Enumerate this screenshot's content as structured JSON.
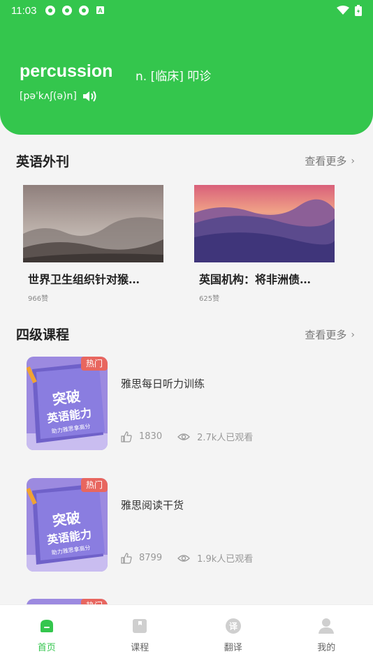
{
  "status_bar": {
    "time": "11:03"
  },
  "word_card": {
    "word": "percussion",
    "meaning": "n. [临床] 叩诊",
    "phonetic": "[pəˈkʌʃ(ə)n]"
  },
  "magazine_section": {
    "title": "英语外刊",
    "more_label": "查看更多",
    "articles": [
      {
        "title": "世界卫生组织针对猴…",
        "likes": "966赞"
      },
      {
        "title": "英国机构：将非洲债…",
        "likes": "625赞"
      }
    ]
  },
  "course_section": {
    "title": "四级课程",
    "more_label": "查看更多",
    "cover": {
      "badge": "热门",
      "line1": "突破",
      "line2": "英语能力",
      "line3": "助力雅思拿高分"
    },
    "courses": [
      {
        "title": "雅思每日听力训练",
        "likes": "1830",
        "views": "2.7k人已观看"
      },
      {
        "title": "雅思阅读干货",
        "likes": "8799",
        "views": "1.9k人已观看"
      },
      {
        "badge_partial": "热门"
      }
    ]
  },
  "tab_bar": {
    "tabs": [
      {
        "label": "首页",
        "icon": "home-icon",
        "active": true
      },
      {
        "label": "课程",
        "icon": "book-icon",
        "active": false
      },
      {
        "label": "翻译",
        "icon": "translate-icon",
        "active": false
      },
      {
        "label": "我的",
        "icon": "profile-icon",
        "active": false
      }
    ]
  },
  "colors": {
    "accent": "#34c64d",
    "background": "#f4f4f4"
  }
}
